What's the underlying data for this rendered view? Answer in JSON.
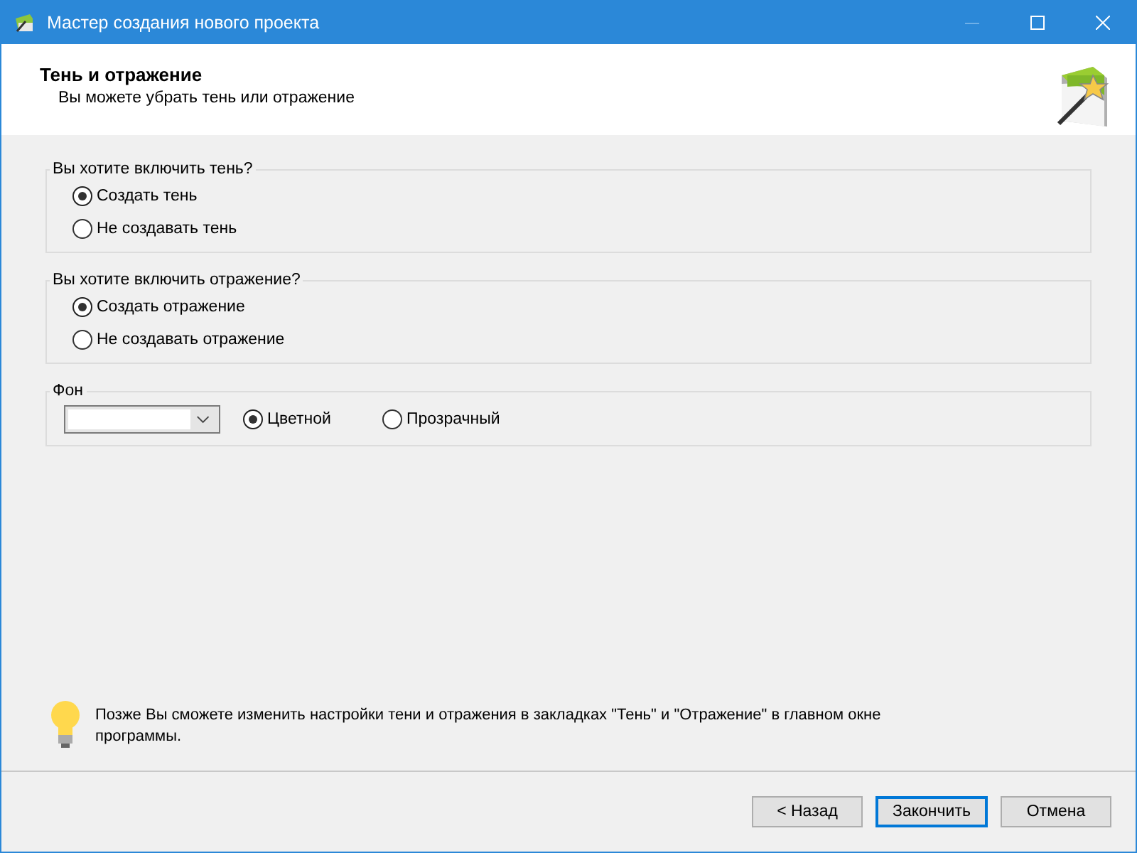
{
  "window": {
    "title": "Мастер создания нового проекта"
  },
  "header": {
    "title": "Тень и отражение",
    "subtitle": "Вы можете убрать тень или отражение"
  },
  "groups": [
    {
      "legend": "Вы хотите включить тень?",
      "options": [
        {
          "label": "Создать тень",
          "selected": true
        },
        {
          "label": "Не создавать тень",
          "selected": false
        }
      ]
    },
    {
      "legend": "Вы хотите включить отражение?",
      "options": [
        {
          "label": "Создать отражение",
          "selected": true
        },
        {
          "label": "Не создавать отражение",
          "selected": false
        }
      ]
    }
  ],
  "background": {
    "legend": "Фон",
    "options": [
      {
        "label": "Цветной",
        "selected": true
      },
      {
        "label": "Прозрачный",
        "selected": false
      }
    ]
  },
  "hint": "Позже Вы сможете изменить настройки тени и отражения в закладках \"Тень\" и \"Отражение\" в главном окне программы.",
  "buttons": [
    {
      "label": "< Назад",
      "default": false
    },
    {
      "label": "Закончить",
      "default": true
    },
    {
      "label": "Отмена",
      "default": false
    }
  ]
}
